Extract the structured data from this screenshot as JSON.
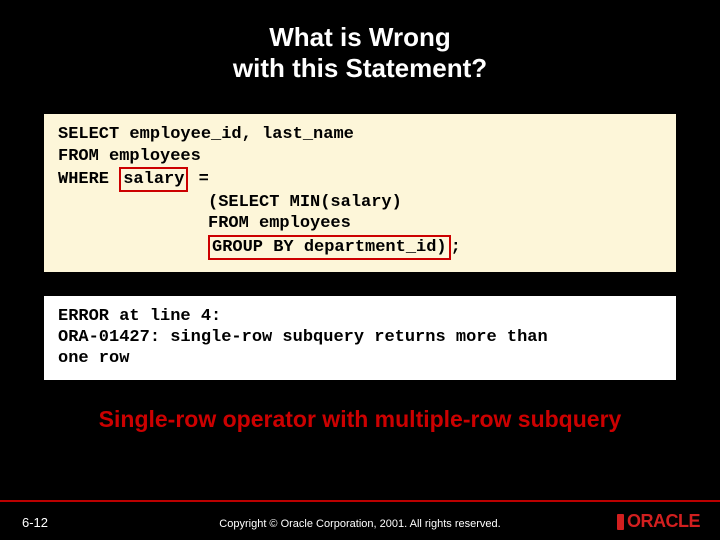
{
  "title_line1": "What is Wrong",
  "title_line2": "with this Statement?",
  "code": {
    "l1a": "SELECT employee_id, last_name",
    "l2a": "FROM   employees",
    "l3a": "WHERE  ",
    "l3hl": "salary",
    "l3b": " =",
    "l4a": "(SELECT   MIN(salary)",
    "l5a": " FROM     employees",
    "l6hl": " GROUP BY department_id)",
    "l6b": ";"
  },
  "error": {
    "l1": "ERROR at line 4:",
    "l2": "ORA-01427: single-row subquery returns more than",
    "l3": "one row"
  },
  "caption": "Single-row operator with multiple-row subquery",
  "footer": {
    "slide_num": "6-12",
    "copyright": "Copyright © Oracle Corporation, 2001. All rights reserved.",
    "logo_text": "ORACLE"
  }
}
